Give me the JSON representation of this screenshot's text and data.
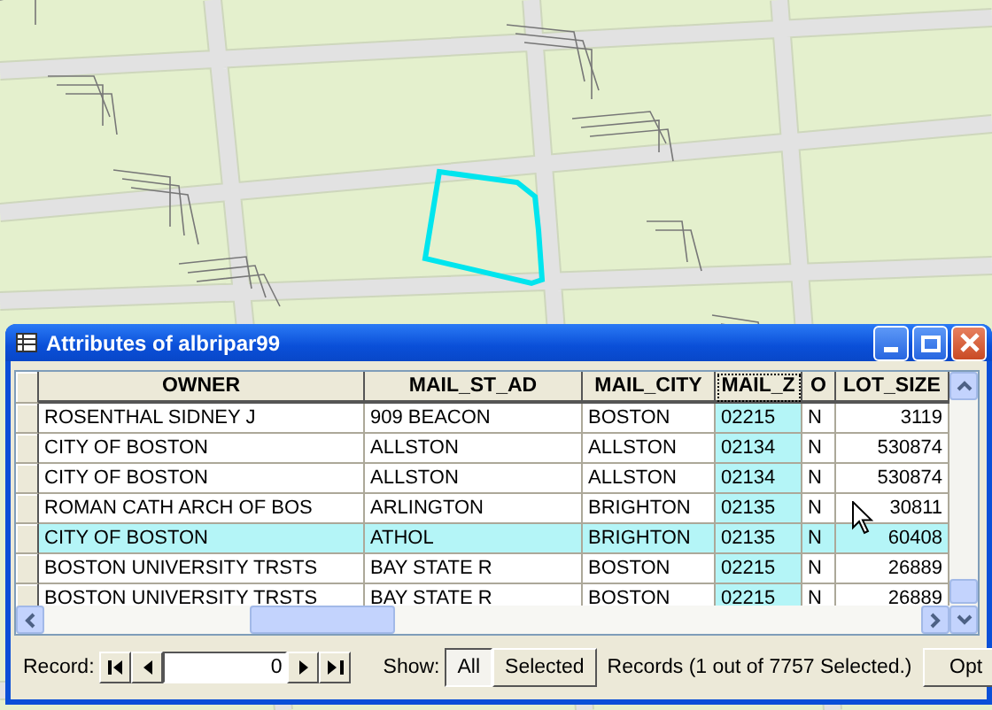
{
  "window": {
    "title": "Attributes of albripar99"
  },
  "table": {
    "columns": [
      {
        "label": "OWNER",
        "kind": "text",
        "selected": false
      },
      {
        "label": "MAIL_ST_AD",
        "kind": "text",
        "selected": false
      },
      {
        "label": "MAIL_CITY",
        "kind": "text",
        "selected": false
      },
      {
        "label": "MAIL_Z",
        "kind": "text",
        "selected": true
      },
      {
        "label": "O",
        "kind": "text",
        "selected": false
      },
      {
        "label": "LOT_SIZE",
        "kind": "number",
        "selected": false
      }
    ],
    "rows": [
      {
        "cells": [
          "ROSENTHAL SIDNEY J",
          "909 BEACON",
          "BOSTON",
          "02215",
          "N",
          "3119"
        ],
        "selected": false
      },
      {
        "cells": [
          "CITY OF BOSTON",
          "ALLSTON",
          "ALLSTON",
          "02134",
          "N",
          "530874"
        ],
        "selected": false
      },
      {
        "cells": [
          "CITY OF BOSTON",
          "ALLSTON",
          "ALLSTON",
          "02134",
          "N",
          "530874"
        ],
        "selected": false
      },
      {
        "cells": [
          "ROMAN CATH ARCH OF BOS",
          "ARLINGTON",
          "BRIGHTON",
          "02135",
          "N",
          "30811"
        ],
        "selected": false
      },
      {
        "cells": [
          "CITY OF BOSTON",
          "ATHOL",
          "BRIGHTON",
          "02135",
          "N",
          "60408"
        ],
        "selected": true
      },
      {
        "cells": [
          "BOSTON UNIVERSITY TRSTS",
          "BAY STATE R",
          "BOSTON",
          "02215",
          "N",
          "26889"
        ],
        "selected": false
      },
      {
        "cells": [
          "BOSTON UNIVERSITY TRSTS",
          "BAY STATE R",
          "BOSTON",
          "02215",
          "N",
          "26889"
        ],
        "selected": false
      }
    ]
  },
  "navigator": {
    "label": "Record:",
    "value": "0"
  },
  "show": {
    "label": "Show:",
    "options": [
      {
        "label": "All",
        "selected": true
      },
      {
        "label": "Selected",
        "selected": false
      }
    ]
  },
  "status": "Records  (1 out of 7757 Selected.)",
  "options_button": "Opt"
}
